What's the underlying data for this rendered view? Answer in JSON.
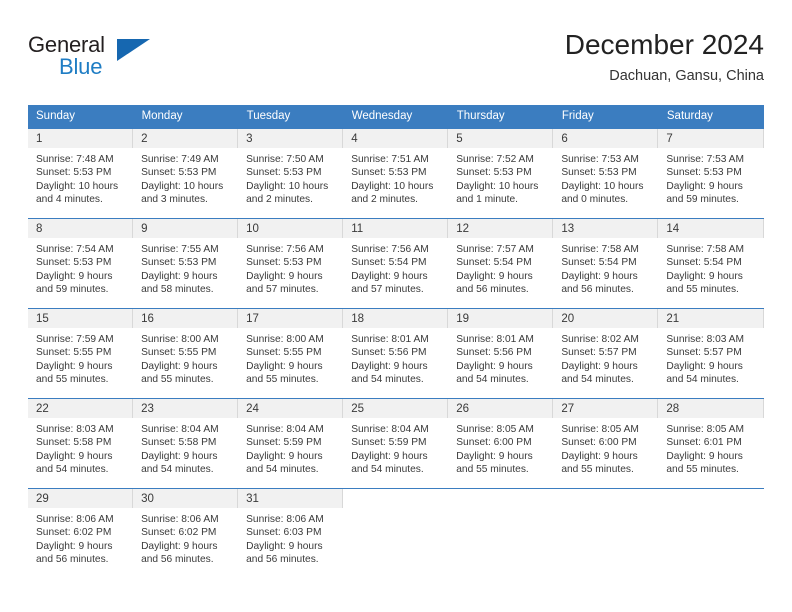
{
  "logo": {
    "word_top": "General",
    "word_bottom": "Blue",
    "triangle_color": "#1667b0",
    "blue_color": "#1f7dc4"
  },
  "header": {
    "title": "December 2024",
    "subtitle": "Dachuan, Gansu, China"
  },
  "theme": {
    "header_blue": "#3b7dc0",
    "daynum_bg": "#f1f1f1",
    "text": "#3a3a3a"
  },
  "calendar": {
    "weekday_headers": [
      "Sunday",
      "Monday",
      "Tuesday",
      "Wednesday",
      "Thursday",
      "Friday",
      "Saturday"
    ],
    "weeks": [
      [
        {
          "day": "1",
          "sunrise": "Sunrise: 7:48 AM",
          "sunset": "Sunset: 5:53 PM",
          "daylight": "Daylight: 10 hours and 4 minutes."
        },
        {
          "day": "2",
          "sunrise": "Sunrise: 7:49 AM",
          "sunset": "Sunset: 5:53 PM",
          "daylight": "Daylight: 10 hours and 3 minutes."
        },
        {
          "day": "3",
          "sunrise": "Sunrise: 7:50 AM",
          "sunset": "Sunset: 5:53 PM",
          "daylight": "Daylight: 10 hours and 2 minutes."
        },
        {
          "day": "4",
          "sunrise": "Sunrise: 7:51 AM",
          "sunset": "Sunset: 5:53 PM",
          "daylight": "Daylight: 10 hours and 2 minutes."
        },
        {
          "day": "5",
          "sunrise": "Sunrise: 7:52 AM",
          "sunset": "Sunset: 5:53 PM",
          "daylight": "Daylight: 10 hours and 1 minute."
        },
        {
          "day": "6",
          "sunrise": "Sunrise: 7:53 AM",
          "sunset": "Sunset: 5:53 PM",
          "daylight": "Daylight: 10 hours and 0 minutes."
        },
        {
          "day": "7",
          "sunrise": "Sunrise: 7:53 AM",
          "sunset": "Sunset: 5:53 PM",
          "daylight": "Daylight: 9 hours and 59 minutes."
        }
      ],
      [
        {
          "day": "8",
          "sunrise": "Sunrise: 7:54 AM",
          "sunset": "Sunset: 5:53 PM",
          "daylight": "Daylight: 9 hours and 59 minutes."
        },
        {
          "day": "9",
          "sunrise": "Sunrise: 7:55 AM",
          "sunset": "Sunset: 5:53 PM",
          "daylight": "Daylight: 9 hours and 58 minutes."
        },
        {
          "day": "10",
          "sunrise": "Sunrise: 7:56 AM",
          "sunset": "Sunset: 5:53 PM",
          "daylight": "Daylight: 9 hours and 57 minutes."
        },
        {
          "day": "11",
          "sunrise": "Sunrise: 7:56 AM",
          "sunset": "Sunset: 5:54 PM",
          "daylight": "Daylight: 9 hours and 57 minutes."
        },
        {
          "day": "12",
          "sunrise": "Sunrise: 7:57 AM",
          "sunset": "Sunset: 5:54 PM",
          "daylight": "Daylight: 9 hours and 56 minutes."
        },
        {
          "day": "13",
          "sunrise": "Sunrise: 7:58 AM",
          "sunset": "Sunset: 5:54 PM",
          "daylight": "Daylight: 9 hours and 56 minutes."
        },
        {
          "day": "14",
          "sunrise": "Sunrise: 7:58 AM",
          "sunset": "Sunset: 5:54 PM",
          "daylight": "Daylight: 9 hours and 55 minutes."
        }
      ],
      [
        {
          "day": "15",
          "sunrise": "Sunrise: 7:59 AM",
          "sunset": "Sunset: 5:55 PM",
          "daylight": "Daylight: 9 hours and 55 minutes."
        },
        {
          "day": "16",
          "sunrise": "Sunrise: 8:00 AM",
          "sunset": "Sunset: 5:55 PM",
          "daylight": "Daylight: 9 hours and 55 minutes."
        },
        {
          "day": "17",
          "sunrise": "Sunrise: 8:00 AM",
          "sunset": "Sunset: 5:55 PM",
          "daylight": "Daylight: 9 hours and 55 minutes."
        },
        {
          "day": "18",
          "sunrise": "Sunrise: 8:01 AM",
          "sunset": "Sunset: 5:56 PM",
          "daylight": "Daylight: 9 hours and 54 minutes."
        },
        {
          "day": "19",
          "sunrise": "Sunrise: 8:01 AM",
          "sunset": "Sunset: 5:56 PM",
          "daylight": "Daylight: 9 hours and 54 minutes."
        },
        {
          "day": "20",
          "sunrise": "Sunrise: 8:02 AM",
          "sunset": "Sunset: 5:57 PM",
          "daylight": "Daylight: 9 hours and 54 minutes."
        },
        {
          "day": "21",
          "sunrise": "Sunrise: 8:03 AM",
          "sunset": "Sunset: 5:57 PM",
          "daylight": "Daylight: 9 hours and 54 minutes."
        }
      ],
      [
        {
          "day": "22",
          "sunrise": "Sunrise: 8:03 AM",
          "sunset": "Sunset: 5:58 PM",
          "daylight": "Daylight: 9 hours and 54 minutes."
        },
        {
          "day": "23",
          "sunrise": "Sunrise: 8:04 AM",
          "sunset": "Sunset: 5:58 PM",
          "daylight": "Daylight: 9 hours and 54 minutes."
        },
        {
          "day": "24",
          "sunrise": "Sunrise: 8:04 AM",
          "sunset": "Sunset: 5:59 PM",
          "daylight": "Daylight: 9 hours and 54 minutes."
        },
        {
          "day": "25",
          "sunrise": "Sunrise: 8:04 AM",
          "sunset": "Sunset: 5:59 PM",
          "daylight": "Daylight: 9 hours and 54 minutes."
        },
        {
          "day": "26",
          "sunrise": "Sunrise: 8:05 AM",
          "sunset": "Sunset: 6:00 PM",
          "daylight": "Daylight: 9 hours and 55 minutes."
        },
        {
          "day": "27",
          "sunrise": "Sunrise: 8:05 AM",
          "sunset": "Sunset: 6:00 PM",
          "daylight": "Daylight: 9 hours and 55 minutes."
        },
        {
          "day": "28",
          "sunrise": "Sunrise: 8:05 AM",
          "sunset": "Sunset: 6:01 PM",
          "daylight": "Daylight: 9 hours and 55 minutes."
        }
      ],
      [
        {
          "day": "29",
          "sunrise": "Sunrise: 8:06 AM",
          "sunset": "Sunset: 6:02 PM",
          "daylight": "Daylight: 9 hours and 56 minutes."
        },
        {
          "day": "30",
          "sunrise": "Sunrise: 8:06 AM",
          "sunset": "Sunset: 6:02 PM",
          "daylight": "Daylight: 9 hours and 56 minutes."
        },
        {
          "day": "31",
          "sunrise": "Sunrise: 8:06 AM",
          "sunset": "Sunset: 6:03 PM",
          "daylight": "Daylight: 9 hours and 56 minutes."
        },
        {
          "day": "",
          "sunrise": "",
          "sunset": "",
          "daylight": ""
        },
        {
          "day": "",
          "sunrise": "",
          "sunset": "",
          "daylight": ""
        },
        {
          "day": "",
          "sunrise": "",
          "sunset": "",
          "daylight": ""
        },
        {
          "day": "",
          "sunrise": "",
          "sunset": "",
          "daylight": ""
        }
      ]
    ]
  }
}
